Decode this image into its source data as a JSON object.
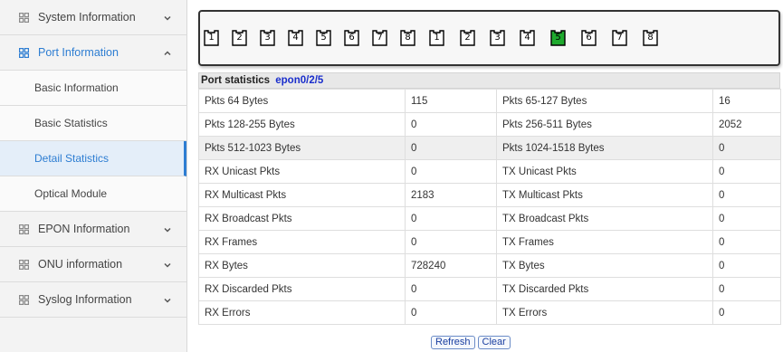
{
  "sidebar": {
    "items": [
      {
        "label": "System Information",
        "icon": "grid-icon",
        "chevron": "down"
      },
      {
        "label": "Port Information",
        "icon": "grid-icon",
        "chevron": "up"
      },
      {
        "label": "EPON Information",
        "icon": "grid-icon",
        "chevron": "down"
      },
      {
        "label": "ONU information",
        "icon": "grid-icon",
        "chevron": "down"
      },
      {
        "label": "Syslog Information",
        "icon": "grid-icon",
        "chevron": "down"
      }
    ],
    "sub_items": [
      "Basic Information",
      "Basic Statistics",
      "Detail Statistics",
      "Optical Module"
    ],
    "active_sub_item": "Detail Statistics",
    "accent_color": "#2d7dd2"
  },
  "ports": {
    "labels": [
      "1",
      "2",
      "3",
      "4",
      "5",
      "6",
      "7",
      "8",
      "1",
      "2",
      "3",
      "4",
      "5",
      "6",
      "7",
      "8"
    ],
    "selected_index": 12,
    "selected_color": "#1faa2e"
  },
  "stats": {
    "title": "Port statistics",
    "port_id": "epon0/2/5",
    "rows": [
      {
        "l1": "Pkts 64 Bytes",
        "v1": "115",
        "l2": "Pkts 65-127 Bytes",
        "v2": "16"
      },
      {
        "l1": "Pkts 128-255 Bytes",
        "v1": "0",
        "l2": "Pkts 256-511 Bytes",
        "v2": "2052"
      },
      {
        "l1": "Pkts 512-1023 Bytes",
        "v1": "0",
        "l2": "Pkts 1024-1518 Bytes",
        "v2": "0"
      },
      {
        "l1": "RX Unicast Pkts",
        "v1": "0",
        "l2": "TX Unicast Pkts",
        "v2": "0"
      },
      {
        "l1": "RX Multicast Pkts",
        "v1": "2183",
        "l2": "TX Multicast Pkts",
        "v2": "0"
      },
      {
        "l1": "RX Broadcast Pkts",
        "v1": "0",
        "l2": "TX Broadcast Pkts",
        "v2": "0"
      },
      {
        "l1": "RX Frames",
        "v1": "0",
        "l2": "TX Frames",
        "v2": "0"
      },
      {
        "l1": "RX Bytes",
        "v1": "728240",
        "l2": "TX Bytes",
        "v2": "0"
      },
      {
        "l1": "RX Discarded Pkts",
        "v1": "0",
        "l2": "TX Discarded Pkts",
        "v2": "0"
      },
      {
        "l1": "RX Errors",
        "v1": "0",
        "l2": "TX Errors",
        "v2": "0"
      }
    ],
    "highlighted_row": 2
  },
  "buttons": {
    "refresh": "Refresh",
    "clear": "Clear"
  }
}
